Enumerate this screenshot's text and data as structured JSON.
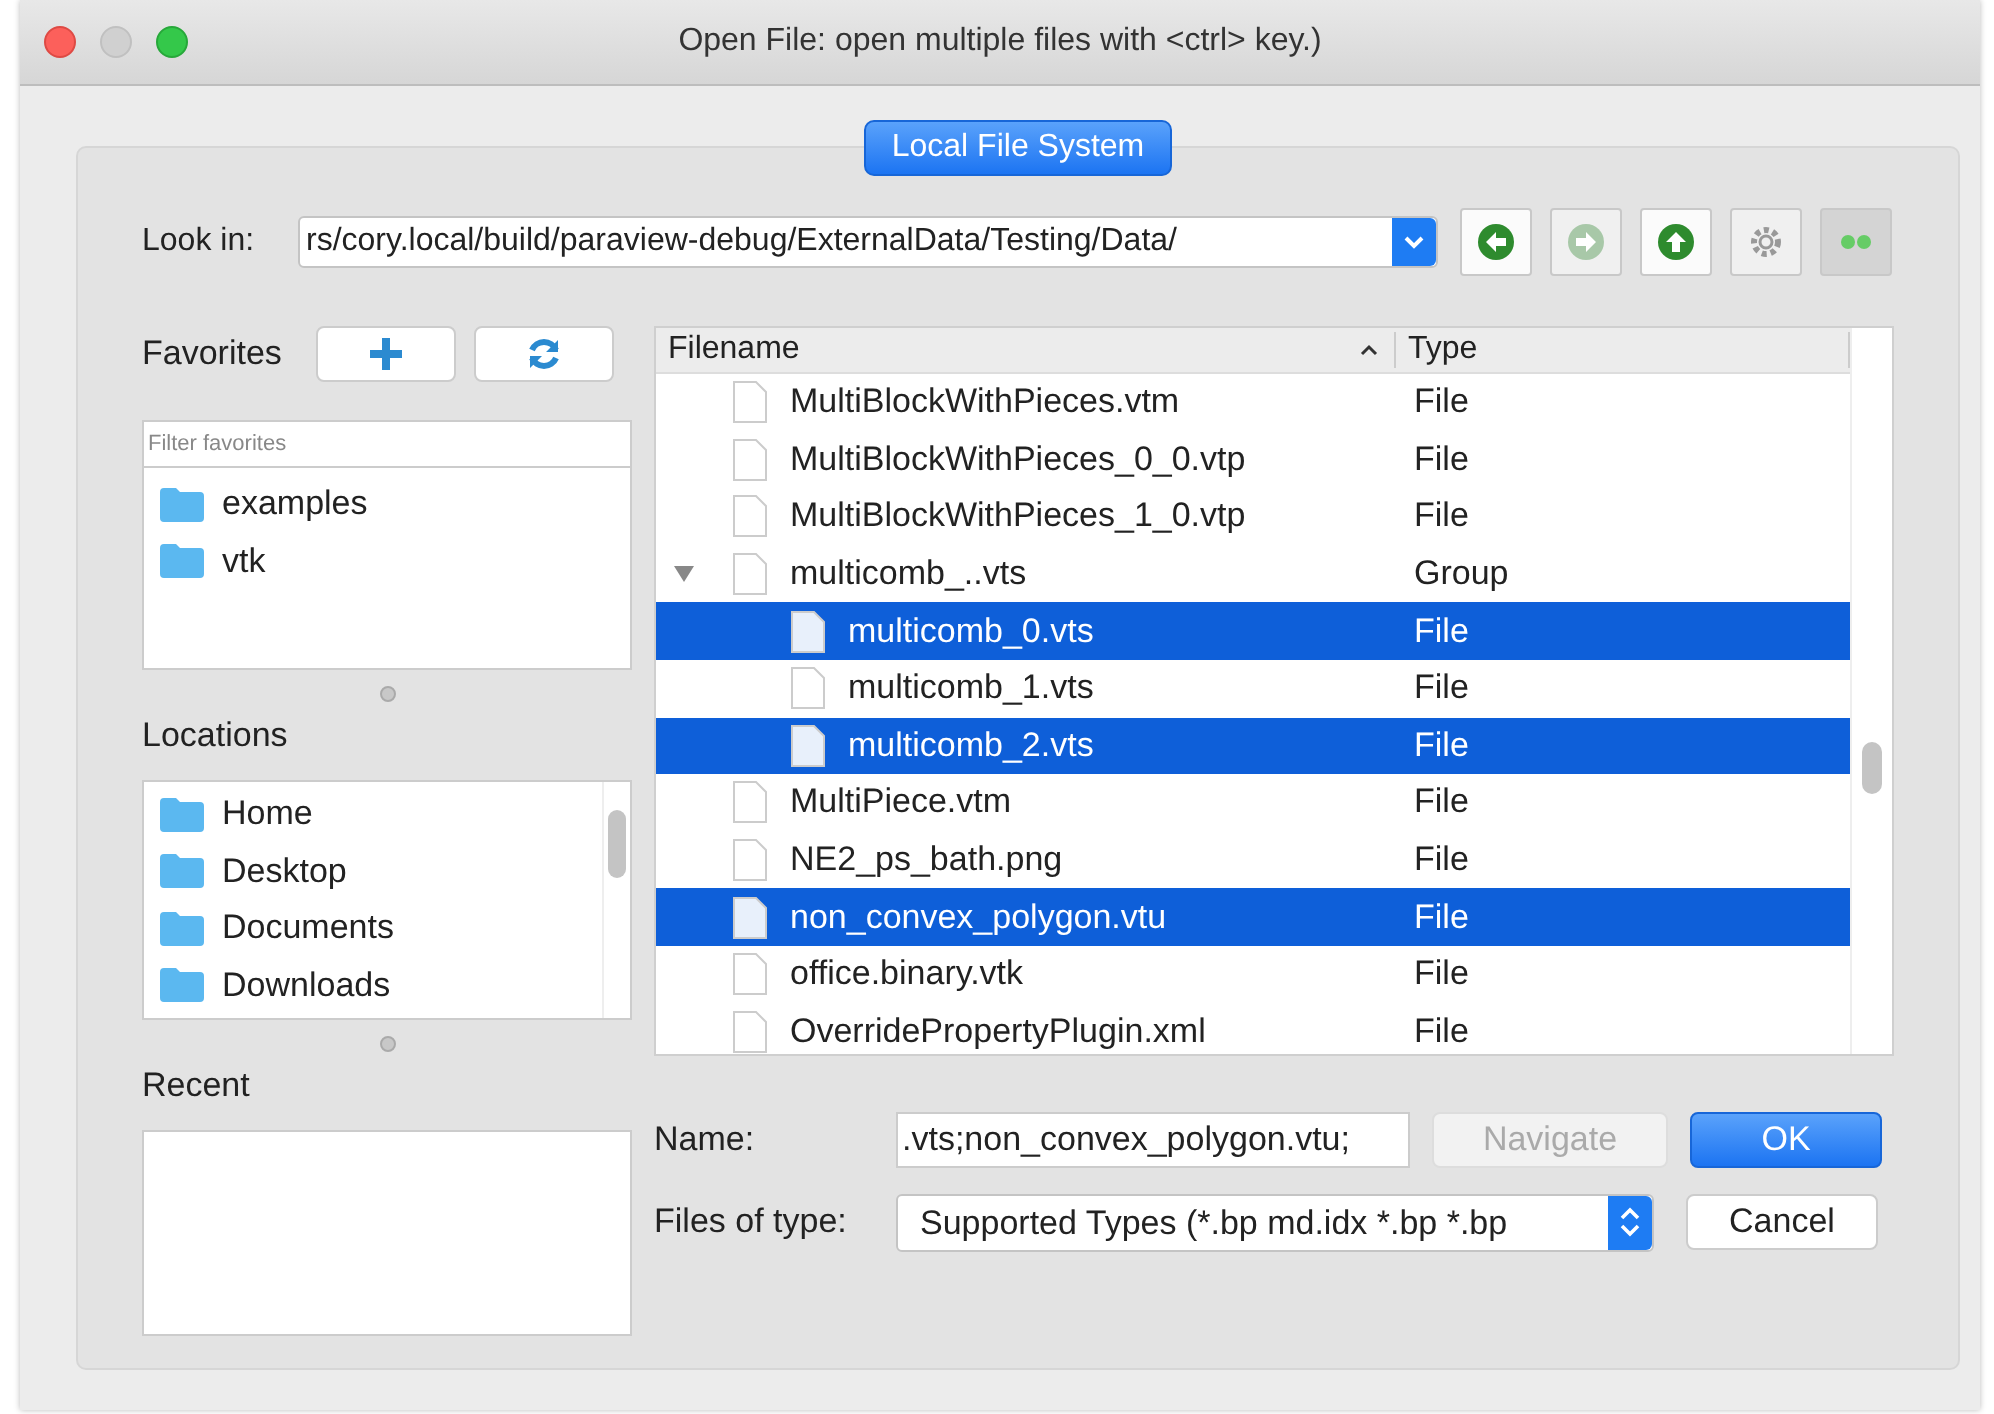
{
  "window": {
    "title": "Open File:  open multiple files with <ctrl> key.)"
  },
  "tab": {
    "label": "Local File System",
    "selected": true
  },
  "look_in": {
    "label": "Look in:",
    "value": "rs/cory.local/build/paraview-debug/ExternalData/Testing/Data/"
  },
  "nav_buttons": [
    {
      "kind": "back",
      "disabled": false
    },
    {
      "kind": "forward",
      "disabled": true
    },
    {
      "kind": "up",
      "disabled": false
    },
    {
      "kind": "settings",
      "disabled": true
    },
    {
      "kind": "details",
      "disabled": true
    }
  ],
  "favorites": {
    "label": "Favorites",
    "filter_placeholder": "Filter favorites",
    "items": [
      "examples",
      "vtk"
    ]
  },
  "locations": {
    "label": "Locations",
    "items": [
      "Home",
      "Desktop",
      "Documents",
      "Downloads"
    ]
  },
  "recent": {
    "label": "Recent"
  },
  "files": {
    "columns": [
      "Filename",
      "Type"
    ],
    "rows": [
      {
        "name": "MultiBlockWithPieces.vtm",
        "type": "File",
        "selected": false
      },
      {
        "name": "MultiBlockWithPieces_0_0.vtp",
        "type": "File",
        "selected": false
      },
      {
        "name": "MultiBlockWithPieces_1_0.vtp",
        "type": "File",
        "selected": false
      },
      {
        "name": "multicomb_..vts",
        "type": "Group",
        "selected": false,
        "expanded": true,
        "children": [
          {
            "name": "multicomb_0.vts",
            "type": "File",
            "selected": true
          },
          {
            "name": "multicomb_1.vts",
            "type": "File",
            "selected": false
          },
          {
            "name": "multicomb_2.vts",
            "type": "File",
            "selected": true
          }
        ]
      },
      {
        "name": "MultiPiece.vtm",
        "type": "File",
        "selected": false
      },
      {
        "name": "NE2_ps_bath.png",
        "type": "File",
        "selected": false
      },
      {
        "name": "non_convex_polygon.vtu",
        "type": "File",
        "selected": true
      },
      {
        "name": "office.binary.vtk",
        "type": "File",
        "selected": false
      },
      {
        "name": "OverridePropertyPlugin.xml",
        "type": "File",
        "selected": false
      }
    ]
  },
  "name_field": {
    "label": "Name:",
    "value": ".vts;non_convex_polygon.vtu;"
  },
  "type_field": {
    "label": "Files of type:",
    "value": "Supported Types (*.bp md.idx *.bp *.bp"
  },
  "buttons": [
    {
      "label": "Navigate",
      "disabled": true
    },
    {
      "label": "OK",
      "default": true
    },
    {
      "label": "Cancel",
      "default": false
    }
  ]
}
